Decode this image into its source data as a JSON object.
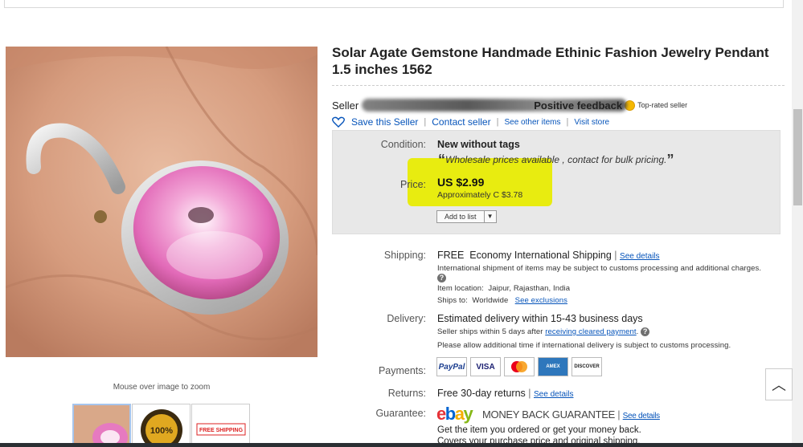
{
  "listing": {
    "title": "Solar Agate Gemstone Handmade Ethinic Fashion Jewelry Pendant 1.5 inches 1562",
    "zoom_hint": "Mouse over image to zoom",
    "thumbnail_badges": [
      "100%",
      "FREE SHIPPING"
    ]
  },
  "seller": {
    "label": "Seller",
    "positive_feedback": "Positive feedback",
    "top_rated": "Top-rated seller",
    "save_seller": "Save this Seller",
    "contact_seller": "Contact seller",
    "see_other_items": "See other items",
    "visit_store": "Visit store"
  },
  "panel": {
    "condition_label": "Condition:",
    "condition_value": "New without tags",
    "wholesale_note": "Wholesale prices available , contact for bulk pricing.",
    "price_label": "Price:",
    "price_value": "US $2.99",
    "price_approx": "Approximately C $3.78",
    "add_to_list": "Add to list"
  },
  "shipping": {
    "label": "Shipping:",
    "free": "FREE",
    "method": "Economy International Shipping",
    "see_details": "See details",
    "note": "International shipment of items may be subject to customs processing and additional charges.",
    "item_location_label": "Item location:",
    "item_location": "Jaipur, Rajasthan, India",
    "ships_to_label": "Ships to:",
    "ships_to": "Worldwide",
    "see_exclusions": "See exclusions"
  },
  "delivery": {
    "label": "Delivery:",
    "estimate": "Estimated delivery within 15-43 business days",
    "ships_within": "Seller ships within 5 days after",
    "receiving_link": "receiving cleared payment",
    "additional": "Please allow additional time if international delivery is subject to customs processing."
  },
  "payments": {
    "label": "Payments:",
    "methods": [
      "PayPal",
      "VISA",
      "MasterCard",
      "AMEX",
      "DISCOVER"
    ]
  },
  "returns": {
    "label": "Returns:",
    "value": "Free 30-day returns",
    "see_details": "See details"
  },
  "guarantee": {
    "label": "Guarantee:",
    "brand": "ebay",
    "text": "MONEY BACK GUARANTEE",
    "see_details": "See details",
    "line1": "Get the item you ordered or get your money back.",
    "line2": "Covers your purchase price and original shipping."
  },
  "colors": {
    "link": "#0654ba",
    "highlight": "#e8ec10",
    "panel_bg": "#e8e8e8"
  }
}
